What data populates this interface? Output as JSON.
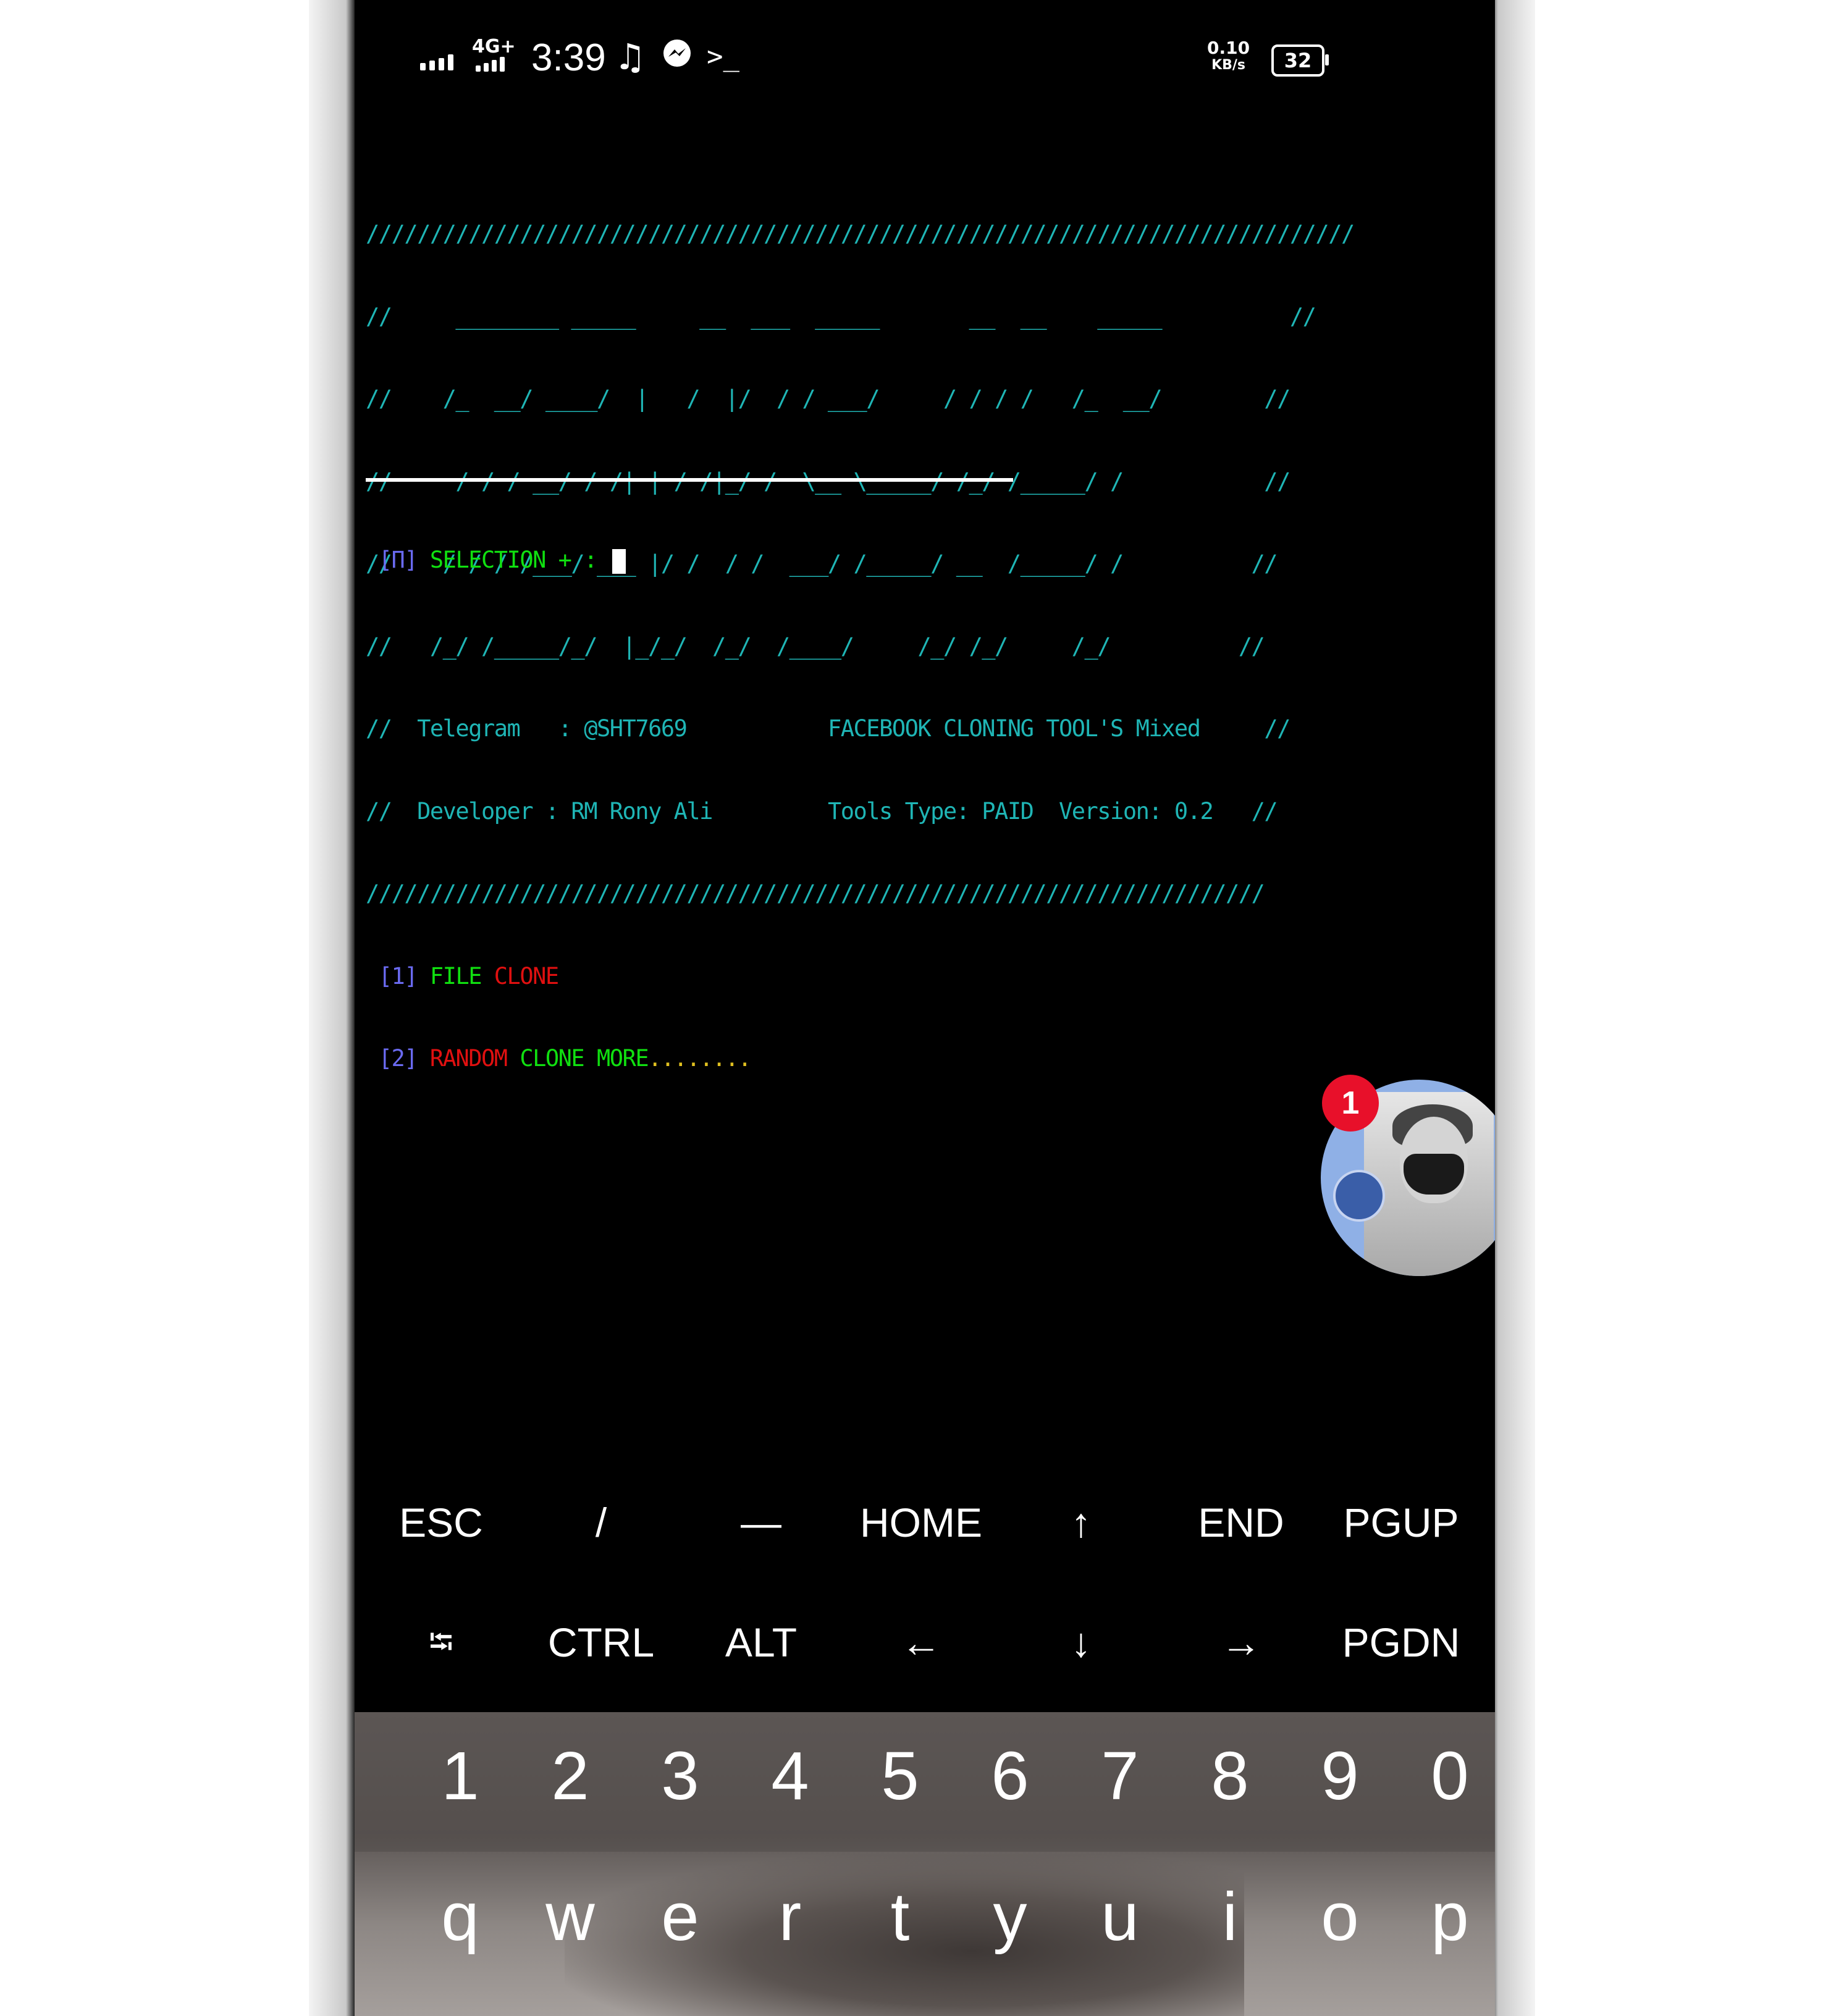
{
  "status_bar": {
    "network": "4G+",
    "time": "3:39",
    "icons": [
      "music-note-icon",
      "messenger-icon",
      "terminal-icon"
    ],
    "speed_value": "0.10",
    "speed_unit": "KB/s",
    "battery": "32"
  },
  "terminal": {
    "banner_lines": [
      "/////////////////////////////////////////////////////////////////////////////",
      "//     ________ _____     __  ___  _____       __  __    _____          //",
      "//    /_  __/ ____/  |   /  |/  / / ___/     / / / /   /_  __/        //",
      "//     / / / __/ / /| | / /|_/ /  \\__ \\_____/ /_/ /_____/ /           //",
      "//    / / / /___/ ___ |/ /  / /  ___/ /_____/ __  /_____/ /          //",
      "//   /_/ /_____/_/  |_/_/  /_/  /____/     /_/ /_/     /_/          //"
    ],
    "telegram_label": "Telegram",
    "telegram_value": "@SHT7669",
    "tool_title": "FACEBOOK CLONING TOOL'S Mixed",
    "developer_label": "Developer",
    "developer_value": "RM Rony Ali",
    "tools_type": "Tools Type: PAID",
    "version": "Version: 0.2",
    "bottom_rule": "//////////////////////////////////////////////////////////////////////",
    "menu": [
      {
        "index": "[1]",
        "word1": "FILE",
        "word2": "CLONE"
      },
      {
        "index": "[2]",
        "word1": "RANDOM",
        "word2": "CLONE",
        "word3": "MORE",
        "dots": "........"
      }
    ],
    "prompt_bracket": "[Π]",
    "prompt_text": "SELECTION + :"
  },
  "chat_head": {
    "badge_count": "1"
  },
  "extra_keys": {
    "row1": [
      "ESC",
      "/",
      "—",
      "HOME",
      "↑",
      "END",
      "PGUP"
    ],
    "row2": [
      "⭾",
      "CTRL",
      "ALT",
      "←",
      "↓",
      "→",
      "PGDN"
    ]
  },
  "keyboard": {
    "numbers": [
      "1",
      "2",
      "3",
      "4",
      "5",
      "6",
      "7",
      "8",
      "9",
      "0"
    ],
    "letters": [
      "q",
      "w",
      "e",
      "r",
      "t",
      "y",
      "u",
      "i",
      "o",
      "p"
    ]
  }
}
